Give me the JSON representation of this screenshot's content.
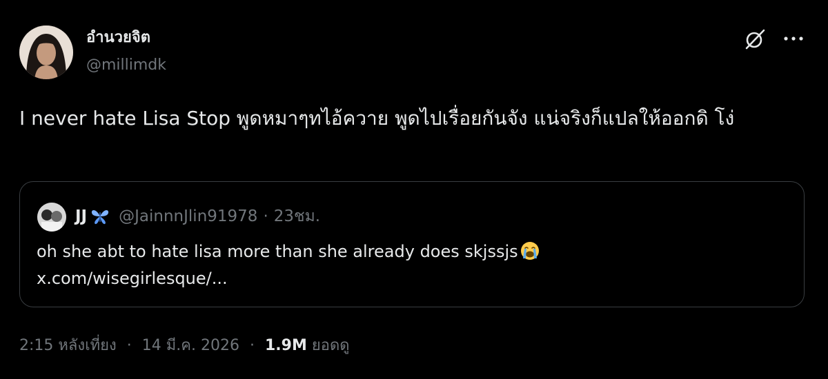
{
  "tweet": {
    "display_name": "อำนวยจิต",
    "handle": "@millimdk",
    "text": "I never hate Lisa Stop พูดหมาๆทไอ้ควาย พูดไปเรื่อยกันจัง แน่จริงก็แปลให้ออกดิ โง่"
  },
  "icons": {
    "grok": "grok-icon",
    "more": "more-icon"
  },
  "quote": {
    "name": "JJ",
    "handle": "@JainnnJlin91978",
    "separator": "·",
    "time": "23ชม.",
    "text": "oh she abt to hate lisa more than she already does skjssjs",
    "link": "x.com/wisegirlesque/..."
  },
  "meta": {
    "time": "2:15 หลังเที่ยง",
    "separator": "·",
    "date": "14 มี.ค. 2026",
    "views_count": "1.9M",
    "views_label": "ยอดดู"
  },
  "colors": {
    "background": "#000000",
    "primary_text": "#e7e9ea",
    "secondary_text": "#71767b",
    "border": "#3a3e42"
  }
}
